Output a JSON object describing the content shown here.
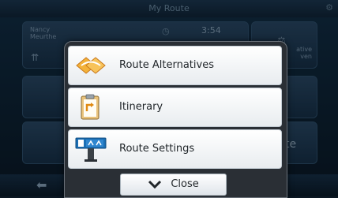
{
  "screen": {
    "title": "My Route"
  },
  "route_summary": {
    "destination_line1": "Nancy",
    "destination_line2": "Meurthe",
    "time": "3:54",
    "clock_icon": "clock-icon",
    "road_icon": "road-icon"
  },
  "alternatives_panel": {
    "text_line1": "ative",
    "text_line2": "ven",
    "icon": "compare-icon"
  },
  "background_buttons": {
    "partial_label": "te"
  },
  "menu": {
    "items": [
      {
        "label": "Route Alternatives",
        "icon": "route-alternatives-icon"
      },
      {
        "label": "Itinerary",
        "icon": "itinerary-icon"
      },
      {
        "label": "Route Settings",
        "icon": "route-settings-icon"
      }
    ],
    "close_label": "Close",
    "close_icon": "chevron-down-icon"
  },
  "colors": {
    "popup_bg": "#2a2f35",
    "item_bg": "#ffffff",
    "accent_blue": "#1b6fb5",
    "orange": "#f0a21c"
  }
}
